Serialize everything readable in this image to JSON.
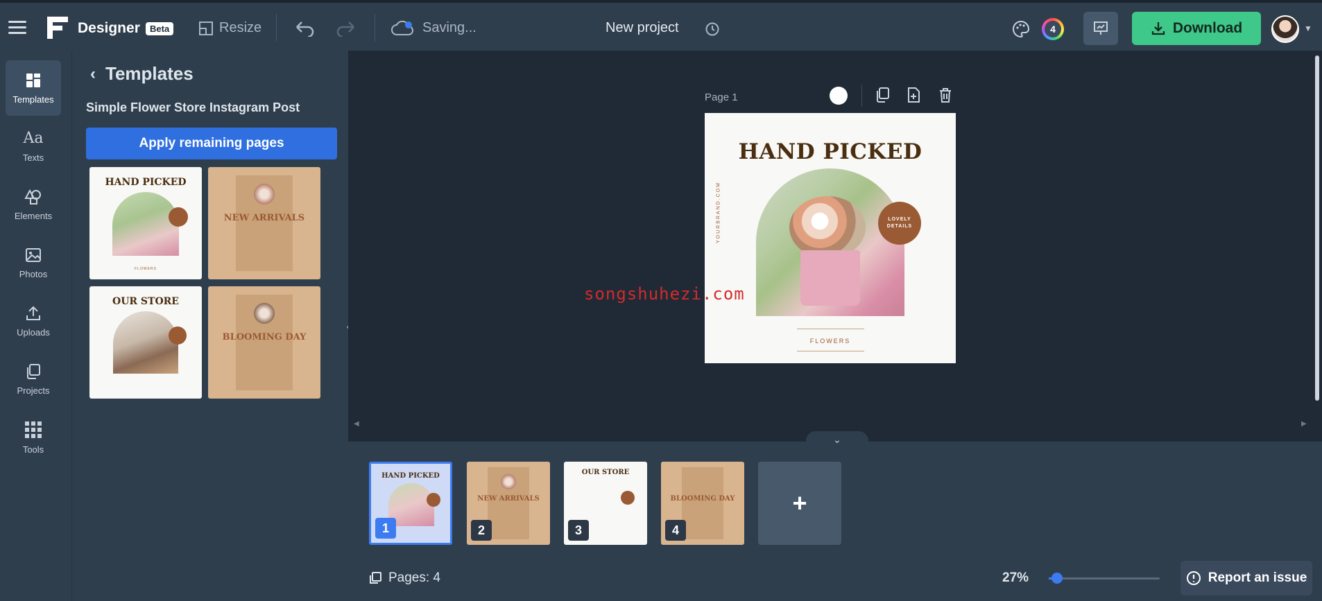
{
  "header": {
    "brand": "Designer",
    "badge": "Beta",
    "resize_label": "Resize",
    "saving_label": "Saving...",
    "project_title": "New project",
    "color_count": "4",
    "download_label": "Download"
  },
  "rail": {
    "items": [
      {
        "label": "Templates"
      },
      {
        "label": "Texts"
      },
      {
        "label": "Elements"
      },
      {
        "label": "Photos"
      },
      {
        "label": "Uploads"
      },
      {
        "label": "Projects"
      },
      {
        "label": "Tools"
      }
    ]
  },
  "panel": {
    "title": "Templates",
    "subtitle": "Simple Flower Store Instagram Post",
    "apply_label": "Apply remaining pages",
    "templates": [
      {
        "title": "HAND PICKED",
        "footer": "FLOWERS"
      },
      {
        "title": "NEW ARRIVALS"
      },
      {
        "title": "OUR STORE"
      },
      {
        "title": "BLOOMING DAY"
      }
    ]
  },
  "canvas": {
    "page_label": "Page 1",
    "design": {
      "headline": "HAND PICKED",
      "side_text": "YOURBRAND.COM",
      "badge_line1": "LOVELY",
      "badge_line2": "DETAILS",
      "footer": "FLOWERS"
    },
    "watermark": "songshuhezi.com"
  },
  "pages": {
    "thumbs": [
      {
        "num": "1",
        "title": "HAND PICKED"
      },
      {
        "num": "2",
        "title": "NEW ARRIVALS"
      },
      {
        "num": "3",
        "title": "OUR STORE"
      },
      {
        "num": "4",
        "title": "BLOOMING DAY"
      }
    ],
    "add_label": "+",
    "count_label": "Pages: 4",
    "zoom": "27%",
    "zoom_fraction": 0.27,
    "report_label": "Report an issue"
  },
  "colors": {
    "accent": "#2f6fe0",
    "download": "#3ec88a",
    "headline": "#4a2e10",
    "badge": "#9a5a33",
    "tan": "#d8b48f"
  }
}
